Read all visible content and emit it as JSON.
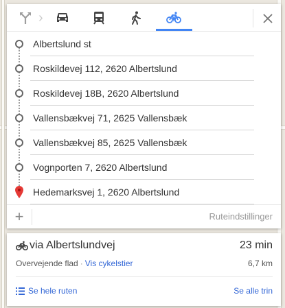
{
  "modes": {
    "best_icon": "turn-arrow-icon",
    "car_icon": "car-icon",
    "transit_icon": "train-icon",
    "walk_icon": "walking-icon",
    "bike_icon": "bicycle-icon",
    "active": "bike",
    "close_icon": "close-icon"
  },
  "stops": [
    {
      "value": "Albertslund st",
      "type": "waypoint"
    },
    {
      "value": "Roskildevej 112, 2620 Albertslund",
      "type": "waypoint"
    },
    {
      "value": "Roskildevej 18B, 2620 Albertslund",
      "type": "waypoint"
    },
    {
      "value": "Vallensbækvej 71, 2625 Vallensbæk",
      "type": "waypoint"
    },
    {
      "value": "Vallensbækvej 85, 2625 Vallensbæk",
      "type": "waypoint"
    },
    {
      "value": "Vognporten 7, 2620 Albertslund",
      "type": "waypoint"
    },
    {
      "value": "Hedemarksvej 1, 2620 Albertslund",
      "type": "destination"
    }
  ],
  "options": {
    "add_label": "+",
    "route_options_label": "Ruteindstillinger"
  },
  "route": {
    "title": "via Albertslundvej",
    "time": "23 min",
    "terrain": "Overvejende flad",
    "separator": "·",
    "bike_paths_link": "Vis cykelstier",
    "distance": "6,7 km",
    "see_route": "Se hele ruten",
    "see_steps": "Se alle trin"
  },
  "colors": {
    "accent": "#4285f4",
    "link": "#3367d6",
    "pin": "#e53935"
  }
}
